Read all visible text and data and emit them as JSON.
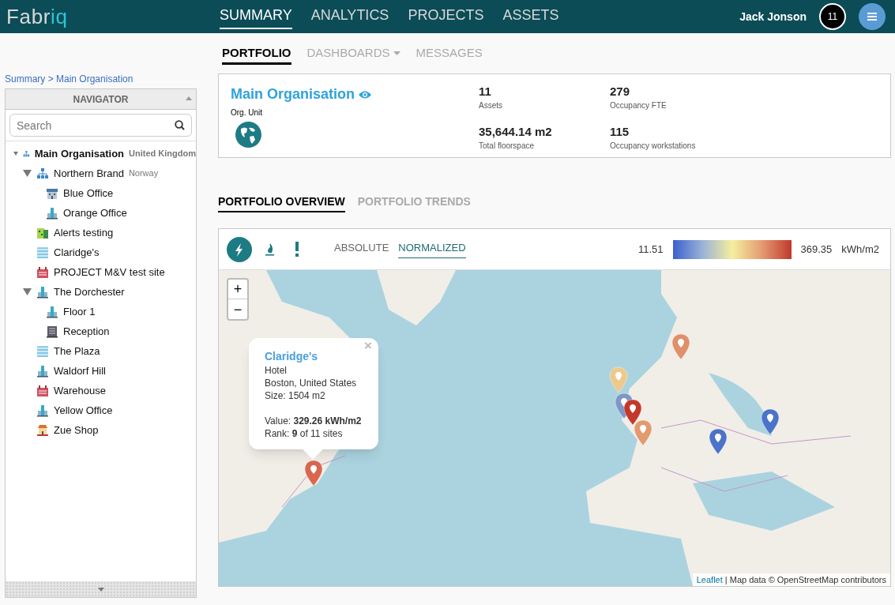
{
  "header": {
    "logo": [
      {
        "text": "Fabr",
        "accent": false
      },
      {
        "text": "iq",
        "accent": true
      }
    ],
    "nav": [
      {
        "label": "SUMMARY",
        "selected": true
      },
      {
        "label": "ANALYTICS",
        "selected": false
      },
      {
        "label": "PROJECTS",
        "selected": false
      },
      {
        "label": "ASSETS",
        "selected": false
      }
    ],
    "user": "Jack Jonson",
    "notifications": "11"
  },
  "subnav": [
    {
      "label": "PORTFOLIO",
      "selected": true,
      "dropdown": false
    },
    {
      "label": "DASHBOARDS",
      "selected": false,
      "dropdown": true
    },
    {
      "label": "MESSAGES",
      "selected": false,
      "dropdown": false
    }
  ],
  "breadcrumb": "Summary > Main Organisation",
  "navigator": {
    "title": "NAVIGATOR",
    "search": {
      "placeholder": "Search"
    },
    "tree": [
      {
        "label": "Main Organisation",
        "note": "United Kingdom",
        "kind": "org",
        "expanded": true,
        "children": [
          {
            "label": "Northern Brand",
            "note": "Norway",
            "kind": "org",
            "expanded": true,
            "children": [
              {
                "label": "Blue Office",
                "kind": "office"
              },
              {
                "label": "Orange Office",
                "kind": "tower"
              }
            ]
          },
          {
            "label": "Alerts testing",
            "kind": "green"
          },
          {
            "label": "Claridge's",
            "kind": "hotel"
          },
          {
            "label": "PROJECT M&V test site",
            "kind": "factory"
          },
          {
            "label": "The Dorchester",
            "kind": "tower",
            "expanded": true,
            "children": [
              {
                "label": "Floor 1",
                "kind": "tower"
              },
              {
                "label": "Reception",
                "kind": "dark"
              }
            ]
          },
          {
            "label": "The Plaza",
            "kind": "hotel"
          },
          {
            "label": "Waldorf Hill",
            "kind": "tower"
          },
          {
            "label": "Warehouse",
            "kind": "factory"
          },
          {
            "label": "Yellow Office",
            "kind": "tower"
          },
          {
            "label": "Zue Shop",
            "kind": "shop"
          }
        ]
      }
    ]
  },
  "summary": {
    "title": "Main Organisation",
    "type": "Org. Unit",
    "metrics": [
      {
        "value": "11",
        "label": "Assets"
      },
      {
        "value": "279",
        "label": "Occupancy FTE"
      },
      {
        "value": "35,644.14 m2",
        "label": "Total floorspace"
      },
      {
        "value": "115",
        "label": "Occupancy workstations"
      }
    ]
  },
  "tabs": [
    {
      "label": "PORTFOLIO OVERVIEW",
      "selected": true
    },
    {
      "label": "PORTFOLIO TRENDS",
      "selected": false
    }
  ],
  "map_toolbar": {
    "energy": [
      {
        "kind": "electricity",
        "selected": true
      },
      {
        "kind": "gas",
        "selected": false
      },
      {
        "kind": "alerts",
        "selected": false
      }
    ],
    "modes": [
      {
        "label": "ABSOLUTE",
        "selected": false
      },
      {
        "label": "NORMALIZED",
        "selected": true
      }
    ],
    "legend": {
      "min": "11.51",
      "max": "369.35",
      "unit": "kWh/m2"
    }
  },
  "map": {
    "zoom_in": "+",
    "zoom_out": "−",
    "markers": [
      {
        "color": "#d9674f"
      },
      {
        "color": "#e0906a"
      },
      {
        "color": "#edc98a"
      },
      {
        "color": "#7e97c7"
      },
      {
        "color": "#c4372b"
      },
      {
        "color": "#e29a6f"
      },
      {
        "color": "#4a73c9"
      },
      {
        "color": "#4a73c9"
      }
    ],
    "popup": {
      "title": "Claridge's",
      "close": "×",
      "lines": [
        "Hotel",
        "Boston, United States",
        "Size: 1504 m2"
      ],
      "details": [
        "Value: **329.26 kWh/m2**",
        "Rank: **9** of 11 sites"
      ]
    },
    "attribution": {
      "link": "Leaflet",
      "text": "| Map data © OpenStreetMap contributors"
    }
  }
}
